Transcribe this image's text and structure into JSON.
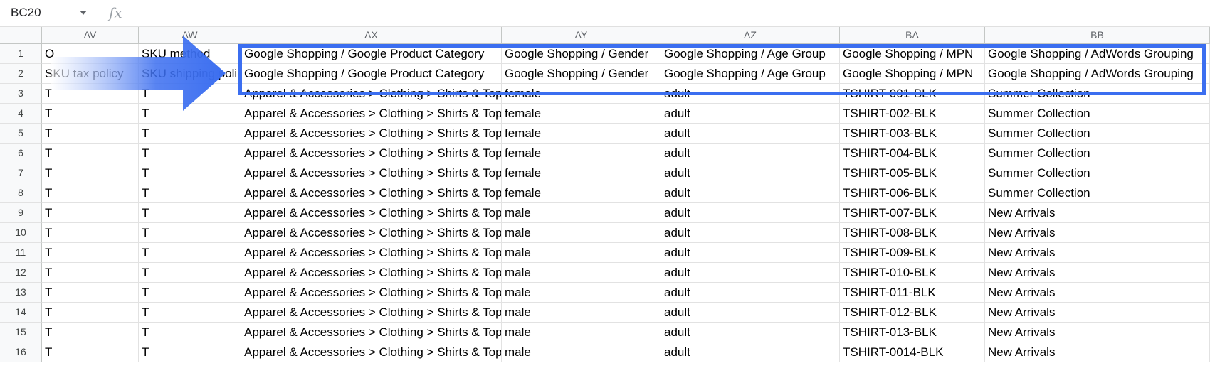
{
  "formula_bar": {
    "cell_ref": "BC20",
    "fx_symbol": "fx",
    "formula": ""
  },
  "columns": [
    "AV",
    "AW",
    "AX",
    "AY",
    "AZ",
    "BA",
    "BB"
  ],
  "rows": [
    {
      "num": "1",
      "cells": [
        "O",
        "SKU method",
        "Google Shopping / Google Product Category",
        "Google Shopping / Gender",
        "Google Shopping / Age Group",
        "Google Shopping / MPN",
        "Google Shopping / AdWords Grouping"
      ]
    },
    {
      "num": "2",
      "cells": [
        "SKU tax policy",
        "SKU shipping policy",
        "Google Shopping / Google Product Category",
        "Google Shopping / Gender",
        "Google Shopping / Age Group",
        "Google Shopping / MPN",
        "Google Shopping / AdWords Grouping"
      ]
    },
    {
      "num": "3",
      "cells": [
        "T",
        "T",
        "Apparel & Accessories > Clothing > Shirts & Tops",
        "female",
        "adult",
        "TSHIRT-001-BLK",
        "Summer Collection"
      ]
    },
    {
      "num": "4",
      "cells": [
        "T",
        "T",
        "Apparel & Accessories > Clothing > Shirts & Tops",
        "female",
        "adult",
        "TSHIRT-002-BLK",
        "Summer Collection"
      ]
    },
    {
      "num": "5",
      "cells": [
        "T",
        "T",
        "Apparel & Accessories > Clothing > Shirts & Tops",
        "female",
        "adult",
        "TSHIRT-003-BLK",
        "Summer Collection"
      ]
    },
    {
      "num": "6",
      "cells": [
        "T",
        "T",
        "Apparel & Accessories > Clothing > Shirts & Tops",
        "female",
        "adult",
        "TSHIRT-004-BLK",
        "Summer Collection"
      ]
    },
    {
      "num": "7",
      "cells": [
        "T",
        "T",
        "Apparel & Accessories > Clothing > Shirts & Tops",
        "female",
        "adult",
        "TSHIRT-005-BLK",
        "Summer Collection"
      ]
    },
    {
      "num": "8",
      "cells": [
        "T",
        "T",
        "Apparel & Accessories > Clothing > Shirts & Tops",
        "female",
        "adult",
        "TSHIRT-006-BLK",
        "Summer Collection"
      ]
    },
    {
      "num": "9",
      "cells": [
        "T",
        "T",
        "Apparel & Accessories > Clothing > Shirts & Tops",
        "male",
        "adult",
        "TSHIRT-007-BLK",
        "New Arrivals"
      ]
    },
    {
      "num": "10",
      "cells": [
        "T",
        "T",
        "Apparel & Accessories > Clothing > Shirts & Tops",
        "male",
        "adult",
        "TSHIRT-008-BLK",
        "New Arrivals"
      ]
    },
    {
      "num": "11",
      "cells": [
        "T",
        "T",
        "Apparel & Accessories > Clothing > Shirts & Tops",
        "male",
        "adult",
        "TSHIRT-009-BLK",
        "New Arrivals"
      ]
    },
    {
      "num": "12",
      "cells": [
        "T",
        "T",
        "Apparel & Accessories > Clothing > Shirts & Tops",
        "male",
        "adult",
        "TSHIRT-010-BLK",
        "New Arrivals"
      ]
    },
    {
      "num": "13",
      "cells": [
        "T",
        "T",
        "Apparel & Accessories > Clothing > Shirts & Tops",
        "male",
        "adult",
        "TSHIRT-011-BLK",
        "New Arrivals"
      ]
    },
    {
      "num": "14",
      "cells": [
        "T",
        "T",
        "Apparel & Accessories > Clothing > Shirts & Tops",
        "male",
        "adult",
        "TSHIRT-012-BLK",
        "New Arrivals"
      ]
    },
    {
      "num": "15",
      "cells": [
        "T",
        "T",
        "Apparel & Accessories > Clothing > Shirts & Tops",
        "male",
        "adult",
        "TSHIRT-013-BLK",
        "New Arrivals"
      ]
    },
    {
      "num": "16",
      "cells": [
        "T",
        "T",
        "Apparel & Accessories > Clothing > Shirts & Tops",
        "male",
        "adult",
        "TSHIRT-0014-BLK",
        "New Arrivals"
      ]
    }
  ],
  "annotation": {
    "highlight_color": "#3b6ef0",
    "arrow_color": "#3b6ef0"
  }
}
